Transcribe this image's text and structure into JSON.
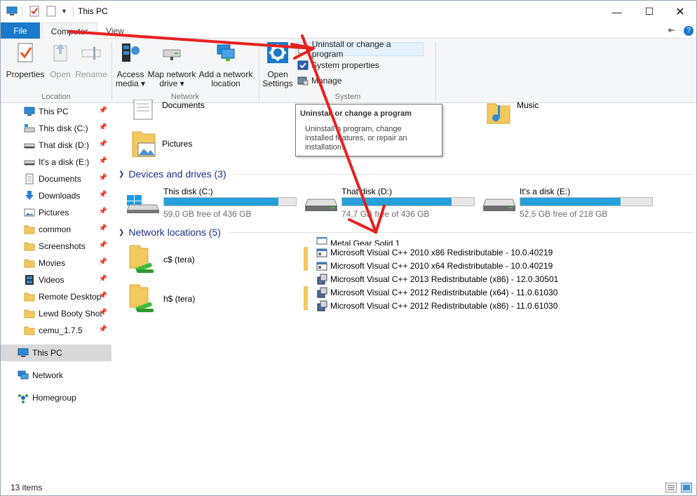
{
  "window": {
    "title": "This PC"
  },
  "tabs": {
    "file": "File",
    "computer": "Computer",
    "view": "View"
  },
  "ribbon": {
    "location": {
      "label": "Location",
      "properties": "Properties",
      "open": "Open",
      "rename": "Rename"
    },
    "network": {
      "label": "Network",
      "access_media_1": "Access",
      "access_media_2": "media ▾",
      "map_drive_1": "Map network",
      "map_drive_2": "drive ▾",
      "add_location_1": "Add a network",
      "add_location_2": "location"
    },
    "system": {
      "label": "System",
      "open_settings_1": "Open",
      "open_settings_2": "Settings",
      "uninstall": "Uninstall or change a program",
      "system_properties": "System properties",
      "manage": "Manage"
    }
  },
  "tooltip": {
    "title": "Uninstall or change a program",
    "body_1": "Uninstall a program, change",
    "body_2": "installed features, or repair an",
    "body_3": "installation."
  },
  "nav": {
    "this_pc_quick": "This PC",
    "c": "This disk (C:)",
    "d": "That disk (D:)",
    "e": "It's a disk (E:)",
    "documents": "Documents",
    "downloads": "Downloads",
    "pictures": "Pictures",
    "common": "common",
    "screenshots": "Screenshots",
    "movies": "Movies",
    "videos": "Videos",
    "remote_desktop": "Remote Desktop",
    "lewd": "Lewd Booty Shot",
    "cemu": "cemu_1.7.5",
    "this_pc": "This PC",
    "network": "Network",
    "homegroup": "Homegroup"
  },
  "content": {
    "folders": {
      "documents": "Documents",
      "music": "Music",
      "pictures": "Pictures"
    },
    "devices_header": "Devices and drives (3)",
    "drives": [
      {
        "name": "This disk (C:)",
        "free": "59,0 GB free of 436 GB",
        "used_fraction": 0.865
      },
      {
        "name": "That disk (D:)",
        "free": "74,7 GB free of 436 GB",
        "used_fraction": 0.829
      },
      {
        "name": "It's a disk (E:)",
        "free": "52,5 GB free of 218 GB",
        "used_fraction": 0.759
      }
    ],
    "network_header": "Network locations (5)",
    "network_items": {
      "c": "c$ (tera)",
      "h": "h$ (tera)"
    },
    "programs": {
      "p0": "Metal Gear Solid 1",
      "p1": "Microsoft Visual C++ 2010  x86 Redistributable - 10.0.40219",
      "p2": "Microsoft Visual C++ 2010  x64 Redistributable - 10.0.40219",
      "p3": "Microsoft Visual C++ 2013 Redistributable (x86) - 12.0.30501",
      "p4": "Microsoft Visual C++ 2012 Redistributable (x64) - 11.0.61030",
      "p5": "Microsoft Visual C++ 2012 Redistributable (x86) - 11.0.61030"
    }
  },
  "status": {
    "count": "13 items"
  },
  "colors": {
    "accent": "#1979ca",
    "drive_fill": "#26a0da",
    "header": "#1e3287",
    "annotation": "#e8211f"
  }
}
